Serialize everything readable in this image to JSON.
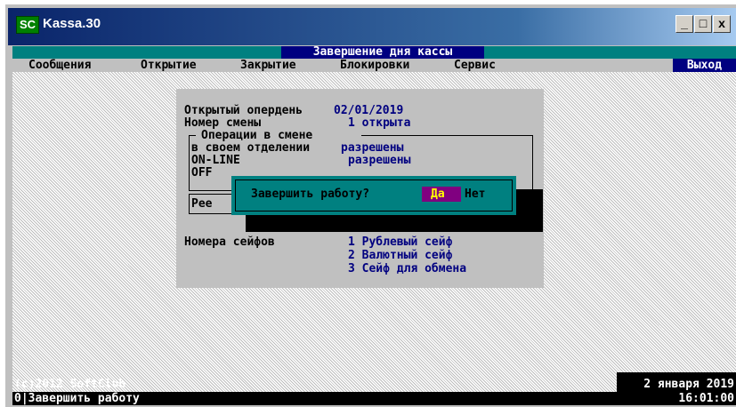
{
  "window": {
    "icon_text": "SC",
    "title": "Kassa.30",
    "controls": {
      "minimize": "_",
      "maximize": "□",
      "close": "x"
    }
  },
  "header": {
    "title": "Завершение дня кассы"
  },
  "menu": {
    "items": [
      "Сообщения",
      "Открытие",
      "Закрытие",
      "Блокировки",
      "Сервис"
    ],
    "exit": "Выход"
  },
  "panel": {
    "open_day_label": "Открытый опердень",
    "open_day_value": "02/01/2019",
    "shift_label": "Номер смены",
    "shift_value": "1 открыта",
    "ops_title": "Операции в смене",
    "ops": [
      {
        "label": "в своем отделении",
        "value": "разрешены"
      },
      {
        "label": "ON-LINE",
        "value": "разрешены"
      },
      {
        "label": "OFF",
        "value": ""
      }
    ],
    "ree_label": "Рее",
    "safes_label": "Номера сейфов",
    "safes": [
      "1 Рублевый сейф",
      "2 Валютный сейф",
      "3 Сейф для обмена"
    ]
  },
  "dialog": {
    "question": "Завершить работу?",
    "yes": "Да",
    "no": "Нет"
  },
  "footer": {
    "copyright": "(c)2012 SoftClub",
    "hint": "0|Завершить работу",
    "date": "2 января 2019",
    "time": "16:01:00"
  },
  "colors": {
    "header_bg": "#000080",
    "teal": "#008080",
    "panel_bg": "#c0c0c0",
    "value_text": "#000080",
    "yes_button_bg": "#800080",
    "yes_button_text": "#ffff00"
  }
}
